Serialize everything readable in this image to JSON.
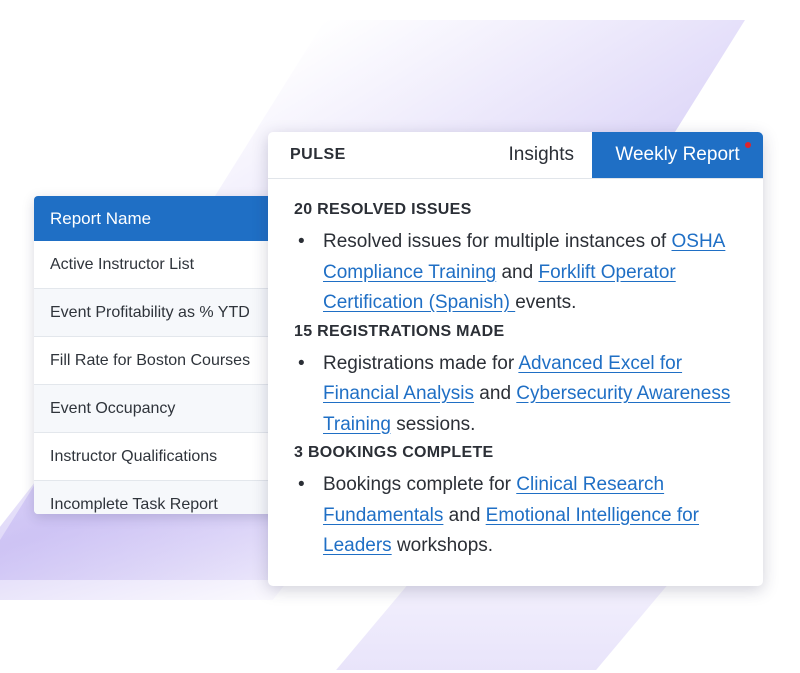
{
  "report_list": {
    "header": "Report Name",
    "items": [
      "Active Instructor List",
      "Event Profitability as % YTD",
      "Fill Rate for Boston Courses",
      "Event Occupancy",
      "Instructor Qualifications",
      "Incomplete Task Report"
    ]
  },
  "pulse": {
    "tabs": {
      "pulse": "PULSE",
      "insights": "Insights",
      "weekly_report": "Weekly Report"
    },
    "sections": [
      {
        "heading": "20 RESOLVED ISSUES",
        "prefix": "Resolved issues for multiple instances of ",
        "link1": "OSHA Compliance Training",
        "middle": " and ",
        "link2": "Forklift Operator Certification (Spanish) ",
        "suffix": "events."
      },
      {
        "heading": "15 REGISTRATIONS MADE",
        "prefix": "Registrations made for ",
        "link1": "Advanced Excel for Financial Analysis",
        "middle": " and ",
        "link2": "Cybersecurity Awareness Training",
        "suffix": " sessions."
      },
      {
        "heading": "3 BOOKINGS COMPLETE",
        "prefix": "Bookings complete for ",
        "link1": "Clinical Research Fundamentals",
        "middle": " and ",
        "link2": "Emotional Intelligence for Leaders",
        "suffix": " workshops."
      }
    ]
  },
  "colors": {
    "accent": "#1f6fc5",
    "notification": "#e0242b",
    "background_shapes": "#c4b8f3"
  }
}
